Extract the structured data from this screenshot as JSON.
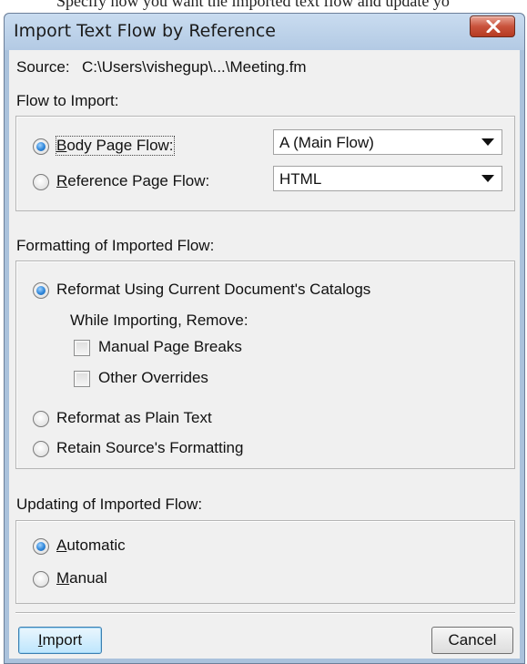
{
  "background_text": "Specify how you want the imported text flow and update yo",
  "dialog": {
    "title": "Import Text Flow by Reference",
    "close_glyph": "X",
    "source": {
      "label": "Source:",
      "value": "C:\\Users\\vishegup\\...\\Meeting.fm"
    }
  },
  "flow_to_import": {
    "heading": "Flow to Import:",
    "body_page_flow": {
      "mnemonic": "B",
      "rest": "ody Page Flow:",
      "selected": true,
      "dropdown_value": "A (Main Flow)"
    },
    "reference_page_flow": {
      "mnemonic": "R",
      "rest": "eference Page Flow:",
      "selected": false,
      "dropdown_value": "HTML"
    }
  },
  "formatting": {
    "heading": "Formatting of Imported Flow:",
    "reformat_catalogs": {
      "label": "Reformat Using Current Document's Catalogs",
      "selected": true
    },
    "while_importing_remove": "While Importing, Remove:",
    "manual_page_breaks": {
      "label": "Manual Page Breaks",
      "checked": false
    },
    "other_overrides": {
      "label": "Other Overrides",
      "checked": false
    },
    "reformat_plain_text": {
      "label": "Reformat as Plain Text",
      "selected": false
    },
    "retain_source": {
      "label": "Retain Source's Formatting",
      "selected": false
    }
  },
  "updating": {
    "heading": "Updating of Imported Flow:",
    "automatic": {
      "mnemonic": "A",
      "rest": "utomatic",
      "selected": true
    },
    "manual": {
      "mnemonic": "M",
      "rest": "anual",
      "selected": false
    }
  },
  "buttons": {
    "import": {
      "mnemonic": "I",
      "rest": "mport"
    },
    "cancel": "Cancel"
  },
  "colors": {
    "title_bar": "#b9cfe8",
    "close_button": "#c7503a",
    "client_background": "#f0f0f0",
    "radio_selected": "#2f86d9",
    "default_button": "#bee6fd"
  },
  "icons": [
    "close-icon",
    "dropdown-arrow-icon"
  ]
}
